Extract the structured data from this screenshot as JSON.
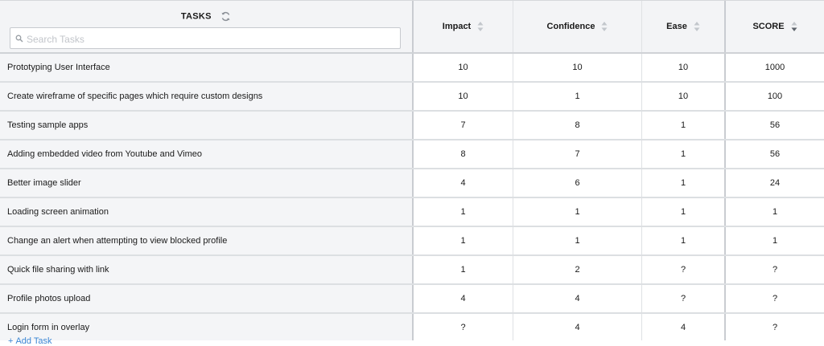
{
  "header": {
    "tasks_label": "TASKS",
    "search_placeholder": "Search Tasks",
    "search_value": "",
    "columns": [
      {
        "key": "impact",
        "label": "Impact",
        "sort": "none"
      },
      {
        "key": "confidence",
        "label": "Confidence",
        "sort": "none"
      },
      {
        "key": "ease",
        "label": "Ease",
        "sort": "none"
      },
      {
        "key": "score",
        "label": "SCORE",
        "sort": "descending"
      }
    ]
  },
  "rows": [
    {
      "task": "Prototyping User Interface",
      "impact": "10",
      "confidence": "10",
      "ease": "10",
      "score": "1000"
    },
    {
      "task": "Create wireframe of specific pages which require custom designs",
      "impact": "10",
      "confidence": "1",
      "ease": "10",
      "score": "100"
    },
    {
      "task": "Testing sample apps",
      "impact": "7",
      "confidence": "8",
      "ease": "1",
      "score": "56"
    },
    {
      "task": "Adding embedded video from Youtube and Vimeo",
      "impact": "8",
      "confidence": "7",
      "ease": "1",
      "score": "56"
    },
    {
      "task": "Better image slider",
      "impact": "4",
      "confidence": "6",
      "ease": "1",
      "score": "24"
    },
    {
      "task": "Loading screen animation",
      "impact": "1",
      "confidence": "1",
      "ease": "1",
      "score": "1"
    },
    {
      "task": "Change an alert when attempting to view blocked profile",
      "impact": "1",
      "confidence": "1",
      "ease": "1",
      "score": "1"
    },
    {
      "task": "Quick file sharing with link",
      "impact": "1",
      "confidence": "2",
      "ease": "?",
      "score": "?"
    },
    {
      "task": "Profile photos upload",
      "impact": "4",
      "confidence": "4",
      "ease": "?",
      "score": "?"
    },
    {
      "task": "Login form in overlay",
      "impact": "?",
      "confidence": "4",
      "ease": "4",
      "score": "?"
    }
  ],
  "footer": {
    "add_task_label": "Add Task"
  },
  "icons": {
    "refresh": "refresh-icon",
    "search": "search-icon",
    "sort": "sort-icon"
  },
  "colors": {
    "accent": "#3a86d4",
    "header_bg": "#f3f4f6",
    "task_bg": "#f4f5f7",
    "border": "#c9ccd1"
  }
}
